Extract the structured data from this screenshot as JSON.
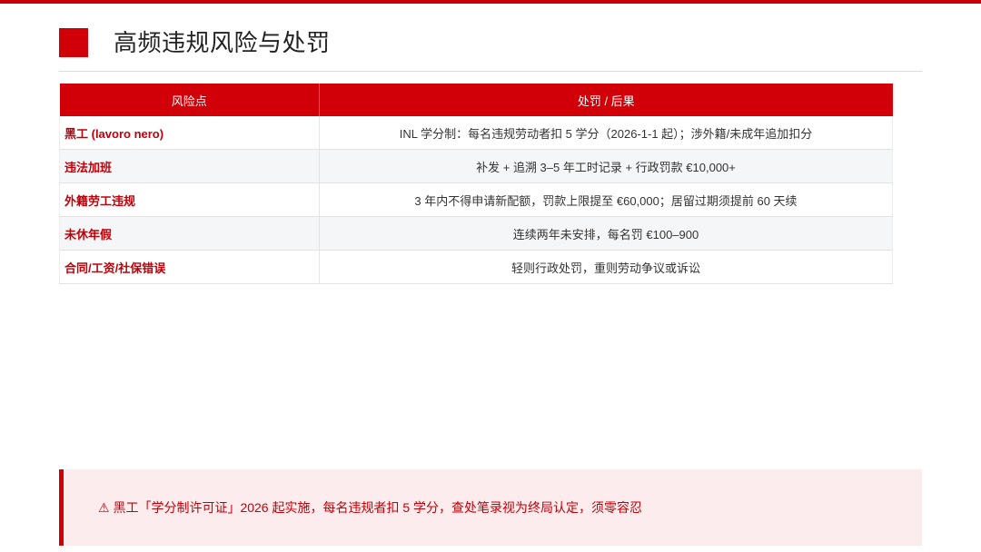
{
  "header": {
    "title": "高频违规风险与处罚"
  },
  "table": {
    "columns": [
      "风险点",
      "处罚 / 后果"
    ],
    "rows": [
      {
        "risk": "黑工 (lavoro nero)",
        "penalty": "INL 学分制：每名违规劳动者扣 5 学分（2026-1-1 起）；涉外籍/未成年追加扣分"
      },
      {
        "risk": "违法加班",
        "penalty": "补发 + 追溯 3–5 年工时记录 + 行政罚款 €10,000+"
      },
      {
        "risk": "外籍劳工违规",
        "penalty": "3 年内不得申请新配额，罚款上限提至 €60,000；居留过期须提前 60 天续"
      },
      {
        "risk": "未休年假",
        "penalty": "连续两年未安排，每名罚 €100–900"
      },
      {
        "risk": "合同/工资/社保错误",
        "penalty": "轻则行政处罚，重则劳动争议或诉讼"
      }
    ]
  },
  "warning": {
    "text": "⚠ 黑工「学分制许可证」2026 起实施，每名违规者扣 5 学分，查处笔录视为终局认定，须零容忍"
  },
  "colors": {
    "accent": "#d10008",
    "warning_bg": "#fdeced",
    "stripe_bg": "#f5f6f7"
  }
}
